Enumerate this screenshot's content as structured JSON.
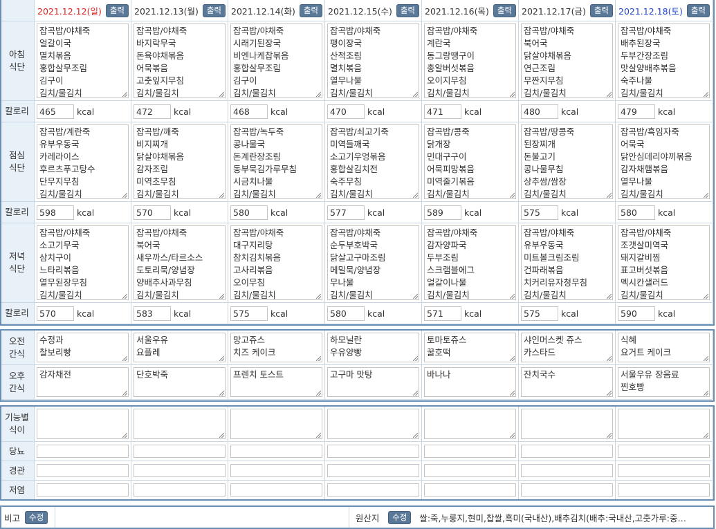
{
  "print_label": "출력",
  "edit_label": "수정",
  "days": [
    {
      "date": "2021.12.12(일)",
      "type": "sun"
    },
    {
      "date": "2021.12.13(월)",
      "type": ""
    },
    {
      "date": "2021.12.14(화)",
      "type": ""
    },
    {
      "date": "2021.12.15(수)",
      "type": ""
    },
    {
      "date": "2021.12.16(목)",
      "type": ""
    },
    {
      "date": "2021.12.17(금)",
      "type": ""
    },
    {
      "date": "2021.12.18(토)",
      "type": "sat"
    }
  ],
  "labels": {
    "breakfast": "아침\n식단",
    "lunch": "점심\n식단",
    "dinner": "저녁\n식단",
    "calorie": "칼로리",
    "am_snack": "오전\n간식",
    "pm_snack": "오후\n간식",
    "functional": "기능별\n식이",
    "diabetes": "당뇨",
    "tube": "경관",
    "low_salt": "저염",
    "note": "비고",
    "origin": "원산지"
  },
  "unit": "kcal",
  "breakfast": [
    "잡곡밥/야채죽\n얼갈이국\n멸치볶음\n홍합살무조림\n김구이\n김치/물김치",
    "잡곡밥/야채죽\n바지락무국\n돈육야채볶음\n어묵볶음\n고춧잎지무침\n김치/물김치",
    "잡곡밥/야채죽\n시래기된장국\n비엔나케찹볶음\n홍합살무조림\n김구이\n김치/물김치",
    "잡곡밥/야채죽\n팽이장국\n산적조림\n멸치볶음\n열무나물\n김치/물김치",
    "잡곡밥/야채죽\n계란국\n동그랑땡구이\n총알버섯볶음\n오이지무침\n김치/물김치",
    "잡곡밥/야채죽\n북어국\n닭살야채볶음\n연근조림\n무짠지무침\n김치/물김치",
    "잡곡밥/야채죽\n배추된장국\n두부간장조림\n맛살양배추볶음\n숙주나물\n김치/물김치"
  ],
  "breakfast_kcal": [
    "465",
    "472",
    "468",
    "470",
    "471",
    "480",
    "479"
  ],
  "lunch": [
    "잡곡밥/계란죽\n유부우동국\n카레라이스\n후르츠푸고탕수\n단무지무침\n김치/물김치",
    "잡곡밥/깨죽\n비지찌개\n닭살야채볶음\n감자조림\n미역초무침\n김치/물김치",
    "잡곡밥/녹두죽\n콩나물국\n돈계란장조림\n동부묵김가루무침\n시금치나물\n김치/물김치",
    "잡곡밥/쇠고기죽\n미역들깨국\n소고기우엉볶음\n홍합살김치전\n숙주무침\n김치/물김치",
    "잡곡밥/콩죽\n닭개장\n민대구구이\n어묵피망볶음\n미역줄기볶음\n김치/물김치",
    "잡곡밥/땅콩죽\n된장찌개\n돈불고기\n콩나물무침\n상추쌈/쌈장\n김치/물김치",
    "잡곡밥/흑임자죽\n어묵국\n닭안심데리야끼볶음\n감자채햄볶음\n열무나물\n김치/물김치"
  ],
  "lunch_kcal": [
    "598",
    "570",
    "580",
    "577",
    "589",
    "575",
    "580"
  ],
  "dinner": [
    "잡곡밥/야채죽\n소고기무국\n삼치구이\n느타리볶음\n열무된장무침\n김치/물김치",
    "잡곡밥/야채죽\n북어국\n새우까스/타르소스\n도토리묵/양념장\n양배추사과무침\n김치/물김치",
    "잡곡밥/야채죽\n대구지리탕\n참치김치볶음\n고사리볶음\n오이무침\n김치/물김치",
    "잡곡밥/야채죽\n순두부호박국\n닭살고구마조림\n메밀묵/양념장\n무나물\n김치/물김치",
    "잡곡밥/야채죽\n감자양파국\n두부조림\n스크램블에그\n얼갈이나물\n김치/물김치",
    "잡곡밥/야채죽\n유부우동국\n미트볼크림조림\n건파래볶음\n치커리유자청무침\n김치/물김치",
    "잡곡밥/야채죽\n조갯살미역국\n돼지갈비찜\n표고버섯볶음\n멕시칸샐러드\n김치/물김치"
  ],
  "dinner_kcal": [
    "570",
    "583",
    "575",
    "580",
    "571",
    "575",
    "590"
  ],
  "am_snack": [
    "수정과\n찰보리빵",
    "서울우유\n요플레",
    "망고쥬스\n치즈 케이크",
    "하모닐란\n우유양빵",
    "토마토쥬스\n꿀호떡",
    "샤인머스켓 쥬스\n카스타드",
    "식혜\n요거트 케이크"
  ],
  "pm_snack": [
    "감자채전",
    "단호박죽",
    "프렌치 토스트",
    "고구마 맛탕",
    "바나나",
    "잔치국수",
    "서울우유 장음료\n찐호빵"
  ],
  "origin_text": "쌀:죽,누룽지,현미,찹쌀,흑미(국내산),배추김치(배추:국내산,고춧가루:중…"
}
